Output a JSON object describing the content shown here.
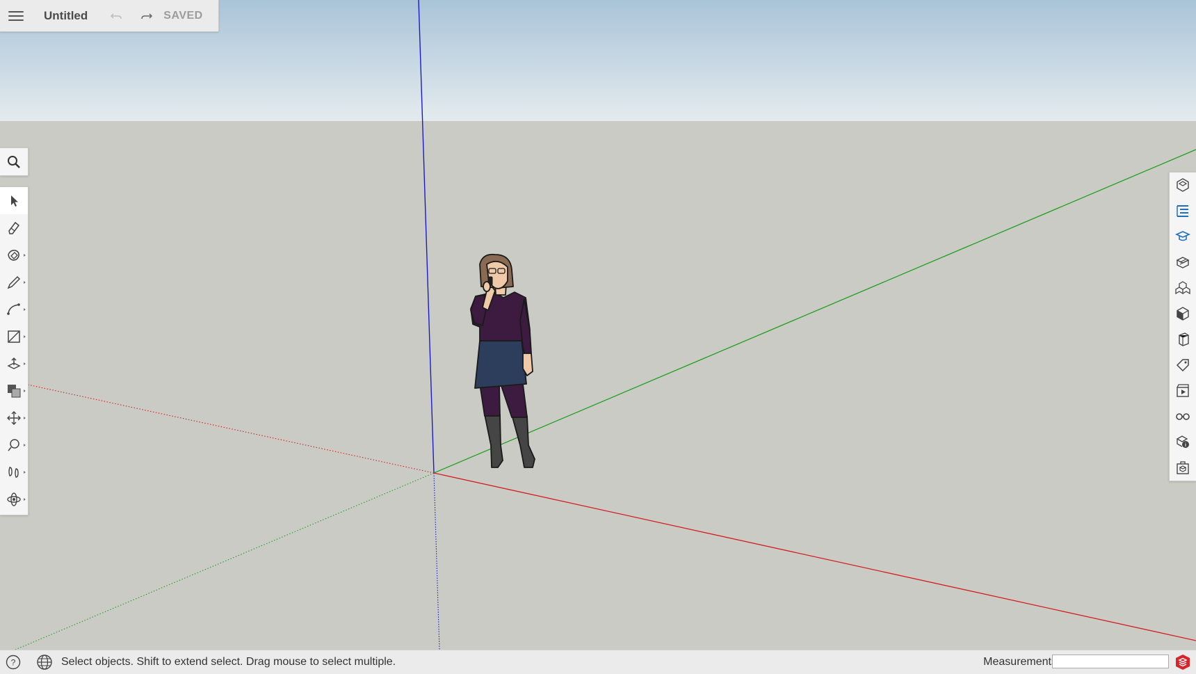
{
  "app": {
    "title": "Untitled",
    "save_state": "SAVED"
  },
  "toolbar": {
    "menu_icon": "hamburger-menu-icon",
    "undo_icon": "undo-icon",
    "redo_icon": "redo-icon"
  },
  "left_toolbar": {
    "search_icon": "search-icon",
    "tools": [
      {
        "name": "select",
        "icon": "select-arrow-icon",
        "active": true
      },
      {
        "name": "eraser",
        "icon": "eraser-icon"
      },
      {
        "name": "paint",
        "icon": "paint-bucket-icon"
      },
      {
        "name": "line",
        "icon": "pencil-icon"
      },
      {
        "name": "arc",
        "icon": "arc-icon"
      },
      {
        "name": "rectangle",
        "icon": "rectangle-icon"
      },
      {
        "name": "push-pull",
        "icon": "push-pull-icon"
      },
      {
        "name": "offset",
        "icon": "offset-icon"
      },
      {
        "name": "move",
        "icon": "move-icon"
      },
      {
        "name": "tape-measure",
        "icon": "tape-measure-icon"
      },
      {
        "name": "walk",
        "icon": "footprints-icon"
      },
      {
        "name": "orbit",
        "icon": "orbit-icon"
      }
    ]
  },
  "right_panel": {
    "items": [
      "entity-info-icon",
      "outliner-icon",
      "instructor-icon",
      "materials-icon",
      "components-icon",
      "styles-icon",
      "scenes-shape-icon",
      "tags-icon",
      "scenes-icon",
      "display-icon",
      "model-info-icon",
      "solid-inspector-icon"
    ]
  },
  "status_bar": {
    "help_icon": "help-icon",
    "globe_icon": "globe-icon",
    "message": "Select objects. Shift to extend select. Drag mouse to select multiple.",
    "measurements_label": "Measurements",
    "measurements_value": ""
  },
  "colors": {
    "sky_top": "#a9c4d8",
    "sky_bottom": "#e4ebee",
    "ground": "#cbcbc6",
    "axis_red": "#d21f1f",
    "axis_green": "#20a020",
    "axis_blue": "#1a1acc",
    "accent_blue": "#1e6fbf",
    "logo_red": "#d7262b"
  }
}
